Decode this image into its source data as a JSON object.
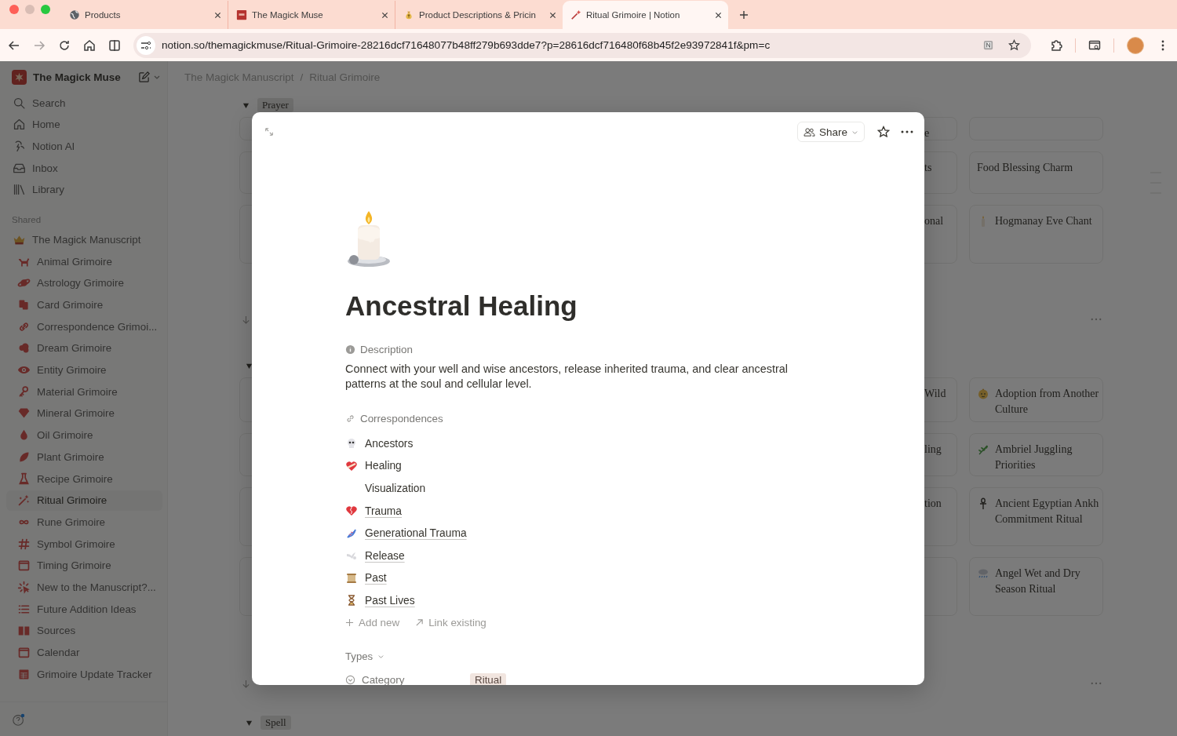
{
  "browser": {
    "tabs": [
      {
        "title": "Products",
        "selected": false
      },
      {
        "title": "The Magick Muse",
        "selected": false
      },
      {
        "title": "Product Descriptions & Pricin",
        "selected": false
      },
      {
        "title": "Ritual Grimoire | Notion",
        "selected": true
      }
    ],
    "url": "notion.so/themagickmuse/Ritual-Grimoire-28216dcf71648077b48ff279b693dde7?p=28616dcf716480f68b45f2e93972841f&pm=c"
  },
  "sidebar": {
    "workspace": "The Magick Muse",
    "nav": [
      "Search",
      "Home",
      "Notion AI",
      "Inbox",
      "Library"
    ],
    "section": "Shared",
    "pages": [
      {
        "label": "The Magick Manuscript",
        "selected": false,
        "children": [
          {
            "label": "Animal Grimoire",
            "selected": false
          },
          {
            "label": "Astrology Grimoire",
            "selected": false
          },
          {
            "label": "Card Grimoire",
            "selected": false
          },
          {
            "label": "Correspondence Grimoi...",
            "selected": false
          },
          {
            "label": "Dream Grimoire",
            "selected": false
          },
          {
            "label": "Entity Grimoire",
            "selected": false
          },
          {
            "label": "Material Grimoire",
            "selected": false
          },
          {
            "label": "Mineral Grimoire",
            "selected": false
          },
          {
            "label": "Oil Grimoire",
            "selected": false
          },
          {
            "label": "Plant Grimoire",
            "selected": false
          },
          {
            "label": "Recipe Grimoire",
            "selected": false
          },
          {
            "label": "Ritual Grimoire",
            "selected": true
          },
          {
            "label": "Rune Grimoire",
            "selected": false
          },
          {
            "label": "Symbol Grimoire",
            "selected": false
          },
          {
            "label": "Timing Grimoire",
            "selected": false
          },
          {
            "label": "New to the Manuscript?...",
            "selected": false
          },
          {
            "label": "Future Addition Ideas",
            "selected": false
          },
          {
            "label": "Sources",
            "selected": false
          },
          {
            "label": "Calendar",
            "selected": false
          },
          {
            "label": "Grimoire Update Tracker",
            "selected": false
          }
        ]
      }
    ]
  },
  "board": {
    "breadcrumb": [
      "The Magick Manuscript",
      "/",
      "Ritual Grimoire"
    ],
    "groups": [
      {
        "name": "Prayer",
        "rows": [
          {
            "partial": "e"
          },
          {
            "partial": "ts",
            "title": "Food Blessing Charm"
          },
          {
            "partial": "onal",
            "title": "Hogmanay Eve Chant"
          }
        ]
      },
      {
        "rows": [
          {
            "partial": "Wild",
            "title": "Adoption from Another Culture"
          },
          {
            "partial": "ling",
            "title": "Ambriel Juggling Priorities"
          },
          {
            "partial": "tion",
            "title": "Ancient Egyptian Ankh Commitment Ritual"
          },
          {
            "title": "Angel Wet and Dry Season Ritual"
          }
        ]
      },
      {
        "name": "Spell"
      }
    ]
  },
  "modal": {
    "share": "Share",
    "title": "Ancestral Healing",
    "description": {
      "label": "Description",
      "text": "Connect with your well and wise ancestors, release inherited trauma, and clear ancestral patterns at the soul and cellular level."
    },
    "correspondences": {
      "label": "Correspondences",
      "items": [
        {
          "label": "Ancestors",
          "underlined": false
        },
        {
          "label": "Healing",
          "underlined": false
        },
        {
          "label": "Visualization",
          "underlined": false
        },
        {
          "label": "Trauma",
          "underlined": true
        },
        {
          "label": "Generational Trauma",
          "underlined": true
        },
        {
          "label": "Release",
          "underlined": true
        },
        {
          "label": "Past",
          "underlined": true
        },
        {
          "label": "Past Lives",
          "underlined": true
        }
      ],
      "add_new": "Add new",
      "link_existing": "Link existing"
    },
    "types_label": "Types",
    "category": {
      "label": "Category",
      "value": "Ritual"
    }
  }
}
